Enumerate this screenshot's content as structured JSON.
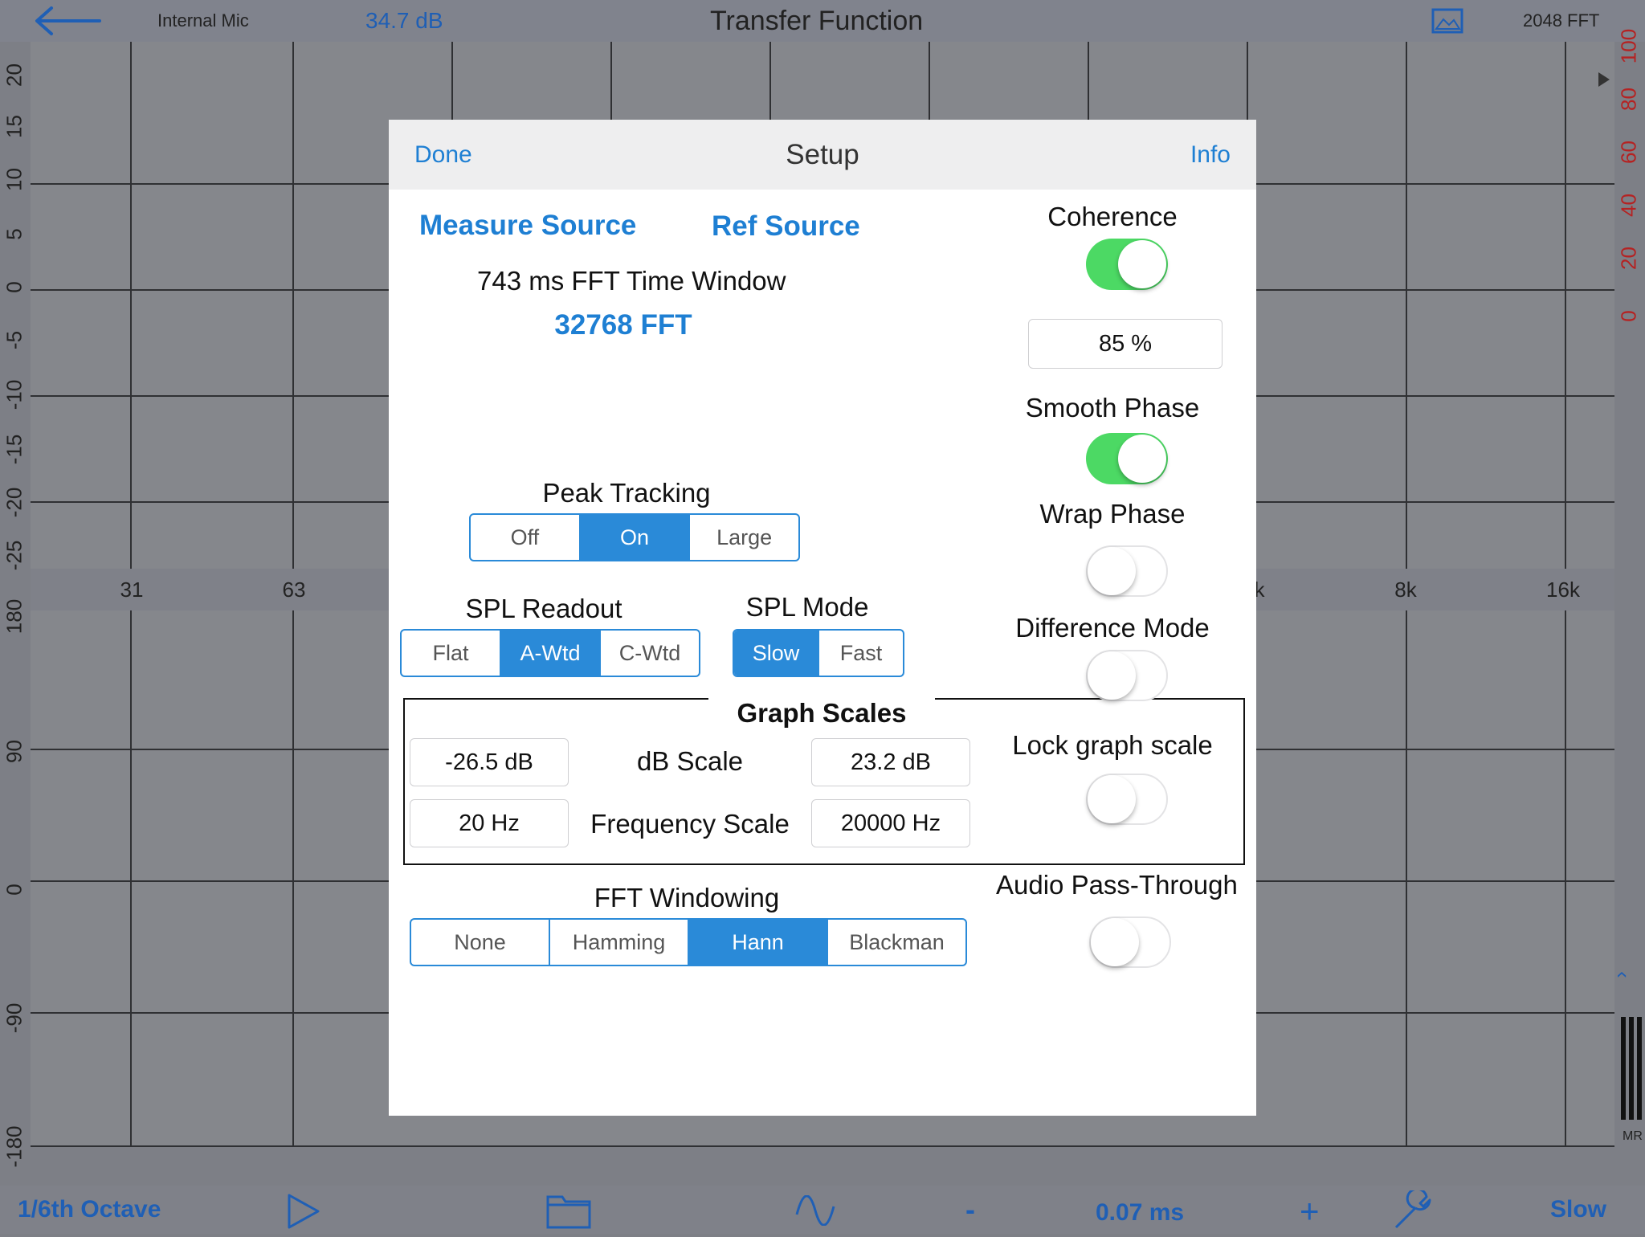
{
  "topbar": {
    "input_name": "Internal Mic",
    "level": "34.7 dB",
    "title": "Transfer Function",
    "fft": "2048 FFT"
  },
  "graph": {
    "magnitude_labels": [
      "20",
      "15",
      "10",
      "5",
      "0",
      "-5",
      "-10",
      "-15",
      "-20",
      "-25"
    ],
    "coherence_labels": [
      "100",
      "80",
      "60",
      "40",
      "20",
      "0"
    ],
    "phase_labels": [
      "180",
      "90",
      "0",
      "-90",
      "-180"
    ],
    "freq_labels": [
      "31",
      "63",
      "8k",
      "16k"
    ],
    "freq_partial": "k",
    "meter_label": "MR"
  },
  "bottombar": {
    "octave": "1/6th Octave",
    "minus": "-",
    "delay": "0.07 ms",
    "plus": "+",
    "speed": "Slow"
  },
  "dialog": {
    "done": "Done",
    "title": "Setup",
    "info": "Info",
    "measure_source": "Measure Source",
    "ref_source": "Ref Source",
    "time_window": "743 ms FFT Time Window",
    "fft_size": "32768 FFT",
    "peak_tracking": {
      "label": "Peak Tracking",
      "options": [
        "Off",
        "On",
        "Large"
      ],
      "selected": "On"
    },
    "spl_readout": {
      "label": "SPL Readout",
      "options": [
        "Flat",
        "A-Wtd",
        "C-Wtd"
      ],
      "selected": "A-Wtd"
    },
    "spl_mode": {
      "label": "SPL Mode",
      "options": [
        "Slow",
        "Fast"
      ],
      "selected": "Slow"
    },
    "graph_scales": {
      "title": "Graph Scales",
      "db_min": "-26.5 dB",
      "db_label": "dB Scale",
      "db_max": "23.2 dB",
      "freq_min": "20 Hz",
      "freq_label": "Frequency Scale",
      "freq_max": "20000 Hz"
    },
    "fft_windowing": {
      "label": "FFT Windowing",
      "options": [
        "None",
        "Hamming",
        "Hann",
        "Blackman"
      ],
      "selected": "Hann"
    },
    "coherence": {
      "label": "Coherence",
      "on": true,
      "value": "85 %"
    },
    "smooth_phase": {
      "label": "Smooth Phase",
      "on": true
    },
    "wrap_phase": {
      "label": "Wrap Phase",
      "on": false
    },
    "difference_mode": {
      "label": "Difference Mode",
      "on": false
    },
    "lock_graph_scale": {
      "label": "Lock graph scale",
      "on": false
    },
    "audio_pass_through": {
      "label": "Audio Pass-Through",
      "on": false
    }
  }
}
